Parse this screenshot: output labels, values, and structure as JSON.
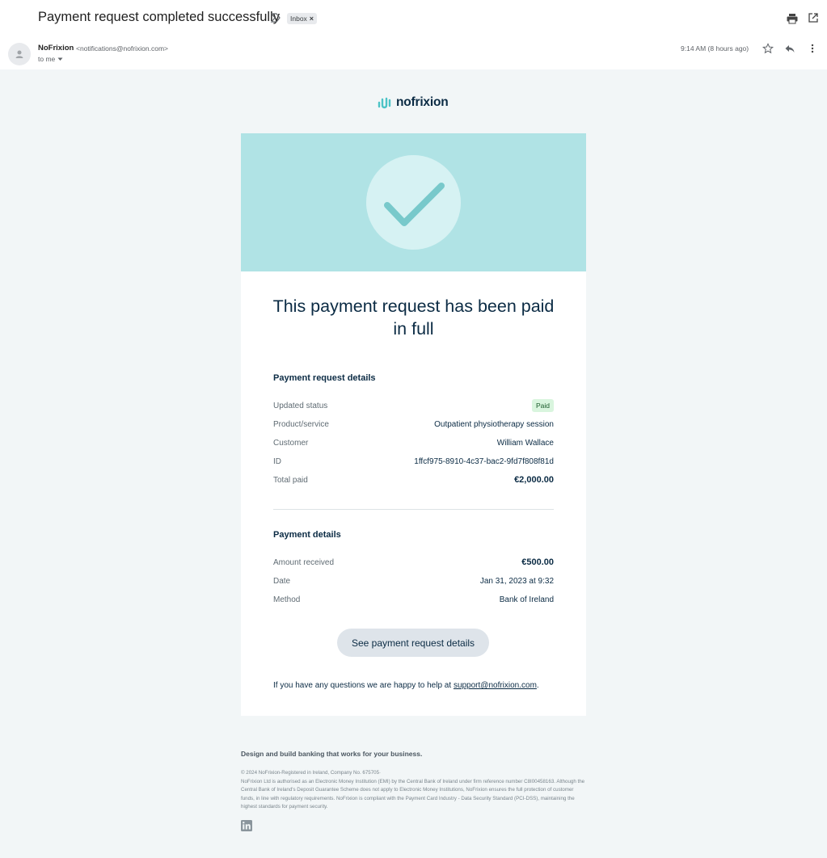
{
  "header": {
    "subject": "Payment request completed successfully",
    "label_chip": "Inbox",
    "label_chip_close": "×"
  },
  "sender": {
    "name": "NoFrixion",
    "email": "<notifications@nofrixion.com>",
    "to": "to me",
    "time": "9:14 AM (8 hours ago)"
  },
  "email": {
    "logo_text": "nofrixion",
    "headline": "This payment request has been paid in full",
    "request_section": {
      "title": "Payment request details",
      "rows": [
        {
          "label": "Updated status",
          "value": "Paid"
        },
        {
          "label": "Product/service",
          "value": "Outpatient physiotherapy session"
        },
        {
          "label": "Customer",
          "value": "William Wallace"
        },
        {
          "label": "ID",
          "value": "1ffcf975-8910-4c37-bac2-9fd7f808f81d"
        },
        {
          "label": "Total paid",
          "value": "€2,000.00"
        }
      ]
    },
    "payment_section": {
      "title": "Payment details",
      "rows": [
        {
          "label": "Amount received",
          "value": "€500.00"
        },
        {
          "label": "Date",
          "value": "Jan 31, 2023 at 9:32"
        },
        {
          "label": "Method",
          "value": "Bank of Ireland"
        }
      ]
    },
    "cta_label": "See payment request details",
    "help_prefix": "If you have any questions we are happy to help at ",
    "help_link": "support@nofrixion.com",
    "help_suffix": ".",
    "footer_tagline": "Design and build banking that works for your business.",
    "footer_legal": [
      "© 2024 NoFrixion-Registered in Ireland, Company No. 675705·",
      "NoFrixion Ltd is authorised as an Electronic Money Institution (EMI) by the Central Bank of Ireland under firm reference number C8I00458163. Although the Central Bank of Ireland's Deposit Guarantee Scheme does not apply to Electronic Money Institutions, NoFrixion ensures the full protection of customer funds, in line with regulatory requirements. NoFrixion is compliant with the Payment Card Industry - Data Security Standard (PCI-DSS), maintaining the highest standards for payment security."
    ]
  },
  "colors": {
    "banner": "#b0e3e5",
    "brand_navy": "#0b2b44",
    "check": "#78c9cb",
    "paid_badge_bg": "#d9f5de"
  },
  "icons": [
    "important-marker-icon",
    "print-icon",
    "open-in-new-window-icon",
    "avatar-icon",
    "chevron-down-icon",
    "star-icon",
    "reply-icon",
    "more-vert-icon",
    "logo-wave-icon",
    "checkmark-icon",
    "linkedin-icon"
  ]
}
